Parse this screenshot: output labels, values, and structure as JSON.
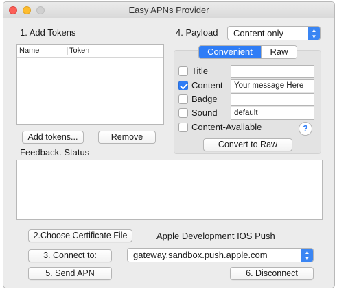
{
  "window": {
    "title": "Easy APNs Provider"
  },
  "tokens": {
    "section_label": "1. Add Tokens",
    "columns": [
      "Name",
      "Token"
    ],
    "add_button": "Add tokens...",
    "remove_button": "Remove"
  },
  "payload": {
    "section_label": "4. Payload",
    "mode_selected": "Content only",
    "segments": {
      "active": "Convenient",
      "inactive": "Raw"
    },
    "fields": [
      {
        "label": "Title",
        "checked": false,
        "value": ""
      },
      {
        "label": "Content",
        "checked": true,
        "value": "Your message Here"
      },
      {
        "label": "Badge",
        "checked": false,
        "value": ""
      },
      {
        "label": "Sound",
        "checked": false,
        "value": "default"
      }
    ],
    "content_available": {
      "label": "Content-Avaliable",
      "checked": false
    },
    "help_glyph": "?",
    "convert_button": "Convert to Raw"
  },
  "feedback": {
    "label": "Feedback. Status",
    "text": ""
  },
  "certificate": {
    "choose_button": "2.Choose Certificate File",
    "name": "Apple Development IOS Push"
  },
  "connection": {
    "connect_button": "3. Connect to:",
    "server_selected": "gateway.sandbox.push.apple.com",
    "send_button": "5. Send APN",
    "disconnect_button": "6. Disconnect"
  },
  "colors": {
    "accent": "#2f7df6",
    "close": "#fc5f57",
    "minimize": "#fdbc2e",
    "zoom": "#d0d0d0"
  },
  "icons": {
    "close": "close-traffic-light-icon",
    "minimize": "minimize-traffic-light-icon",
    "zoom": "zoom-traffic-light-icon",
    "dropdown": "chevron-updown-icon",
    "help": "help-icon",
    "checkmark": "checkmark-icon"
  }
}
